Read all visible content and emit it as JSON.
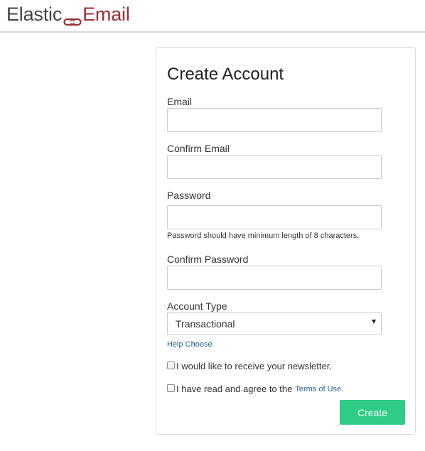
{
  "header": {
    "logo_part1": "Elastic",
    "logo_part2": "Email",
    "logo_color_dark": "#444444",
    "logo_color_brand": "#9c3034"
  },
  "form": {
    "title": "Create Account",
    "email": {
      "label": "Email",
      "value": "",
      "placeholder": ""
    },
    "confirm_email": {
      "label": "Confirm Email",
      "value": "",
      "placeholder": ""
    },
    "password": {
      "label": "Password",
      "value": "",
      "placeholder": "",
      "hint": "Password should have minimum length of 8 characters."
    },
    "confirm_password": {
      "label": "Confirm Password",
      "value": "",
      "placeholder": ""
    },
    "account_type": {
      "label": "Account Type",
      "selected": "Transactional",
      "help_link": "Help Choose"
    },
    "newsletter": {
      "label": "I would like to receive your newsletter.",
      "checked": false
    },
    "terms": {
      "label_prefix": "I have read and agree to the",
      "link_text": "Terms of Use",
      "suffix": ".",
      "checked": false
    },
    "submit_label": "Create",
    "accent_color": "#2ecc84",
    "link_color": "#2a6496"
  }
}
